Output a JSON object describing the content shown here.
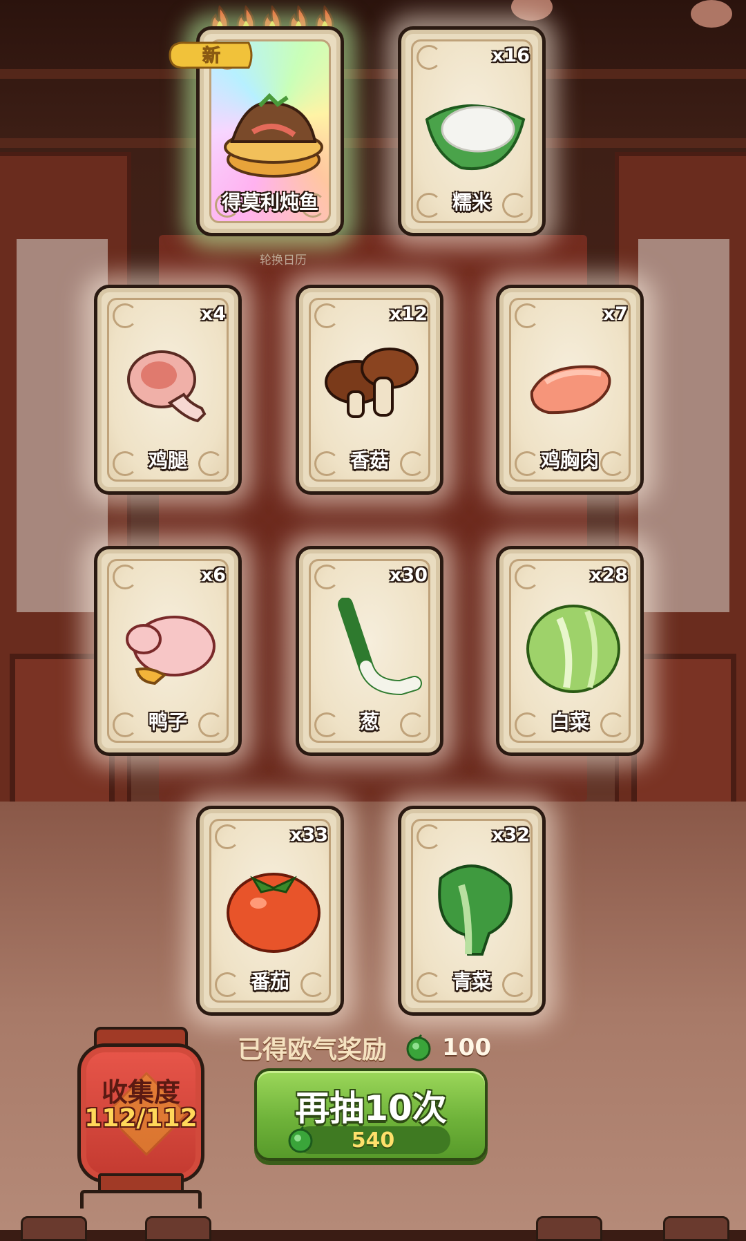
{
  "cards": [
    {
      "id": "fish-stew",
      "name": "得莫利炖鱼",
      "count": "",
      "special": true,
      "icon": "fish-stew-icon"
    },
    {
      "id": "sticky-rice",
      "name": "糯米",
      "count": "x16",
      "special": false,
      "icon": "sticky-rice-icon"
    },
    {
      "id": "chicken-leg",
      "name": "鸡腿",
      "count": "x4",
      "special": false,
      "icon": "chicken-leg-icon"
    },
    {
      "id": "mushroom",
      "name": "香菇",
      "count": "x12",
      "special": false,
      "icon": "mushroom-icon"
    },
    {
      "id": "chicken-breast",
      "name": "鸡胸肉",
      "count": "x7",
      "special": false,
      "icon": "chicken-breast-icon"
    },
    {
      "id": "duck",
      "name": "鸭子",
      "count": "x6",
      "special": false,
      "icon": "duck-icon"
    },
    {
      "id": "scallion",
      "name": "葱",
      "count": "x30",
      "special": false,
      "icon": "scallion-icon"
    },
    {
      "id": "cabbage",
      "name": "白菜",
      "count": "x28",
      "special": false,
      "icon": "cabbage-icon"
    },
    {
      "id": "tomato",
      "name": "番茄",
      "count": "x33",
      "special": false,
      "icon": "tomato-icon"
    },
    {
      "id": "bok-choy",
      "name": "青菜",
      "count": "x32",
      "special": false,
      "icon": "bok-choy-icon"
    }
  ],
  "new_badge": "新",
  "flame_count": 5,
  "background_caption": "轮换日历",
  "reward": {
    "label": "已得欧气奖励",
    "value": "100",
    "icon": "green-coin-icon"
  },
  "draw_button": {
    "label": "再抽10次",
    "cost": "540",
    "icon": "green-coin-icon"
  },
  "collection": {
    "label": "收集度",
    "progress": "112/112"
  },
  "colors": {
    "accent_green": "#6fb33a",
    "card_bg": "#efe2c6",
    "lantern_red": "#e8564a",
    "cost_yellow": "#ffe06b"
  }
}
